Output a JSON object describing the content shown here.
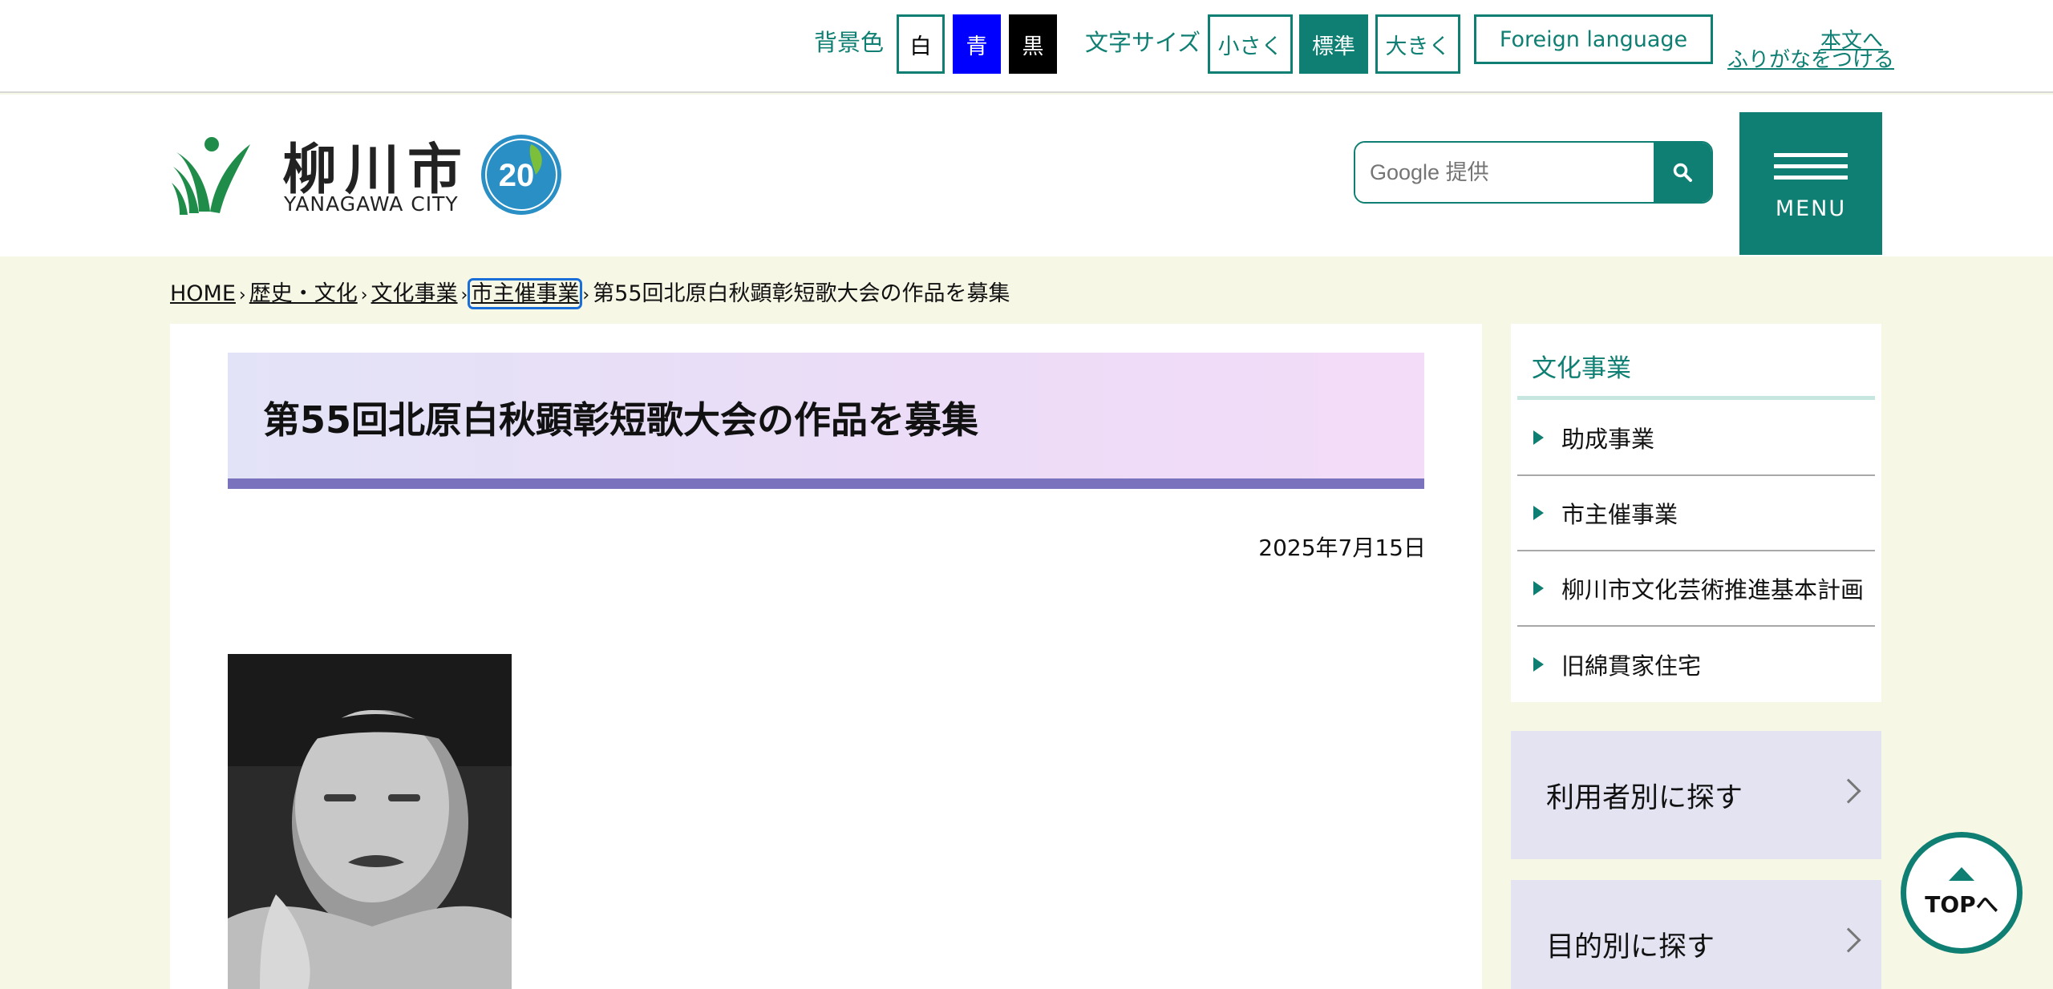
{
  "utility": {
    "bg_label": "背景色",
    "bg_white": "白",
    "bg_blue": "青",
    "bg_black": "黒",
    "size_label": "文字サイズ",
    "size_small": "小さく",
    "size_normal": "標準",
    "size_large": "大きく",
    "foreign": "Foreign language",
    "skip_link": "本文へ",
    "furigana_link": "ふりがなをつける"
  },
  "header": {
    "logo_kanji": "柳川市",
    "logo_en": "YANAGAWA CITY",
    "badge_text": "20",
    "search_placeholder": "Google 提供",
    "menu_label": "MENU"
  },
  "breadcrumb": {
    "items": [
      "HOME",
      "歴史・文化",
      "文化事業",
      "市主催事業"
    ],
    "current": "第55回北原白秋顕彰短歌大会の作品を募集",
    "separator": "›"
  },
  "article": {
    "title": "第55回北原白秋顕彰短歌大会の作品を募集",
    "date": "2025年7月15日"
  },
  "sidebar": {
    "title": "文化事業",
    "items": [
      {
        "label": "助成事業"
      },
      {
        "label": "市主催事業"
      },
      {
        "label": "柳川市文化芸術推進基本計画"
      },
      {
        "label": "旧綿貫家住宅"
      }
    ],
    "find_by_user": "利用者別に探す",
    "find_by_purpose": "目的別に探す"
  },
  "top_button": "TOPへ",
  "colors": {
    "brand": "#0e7f72",
    "title_bar": "#7b72bd",
    "page_bg": "#f7f7e6",
    "find_bg": "#e3e3f2"
  },
  "icons": {
    "search": "search-icon",
    "menu": "hamburger-menu-icon",
    "chevron": "chevron-right-icon",
    "arrow": "triangle-right-icon",
    "top": "triangle-up-icon"
  }
}
